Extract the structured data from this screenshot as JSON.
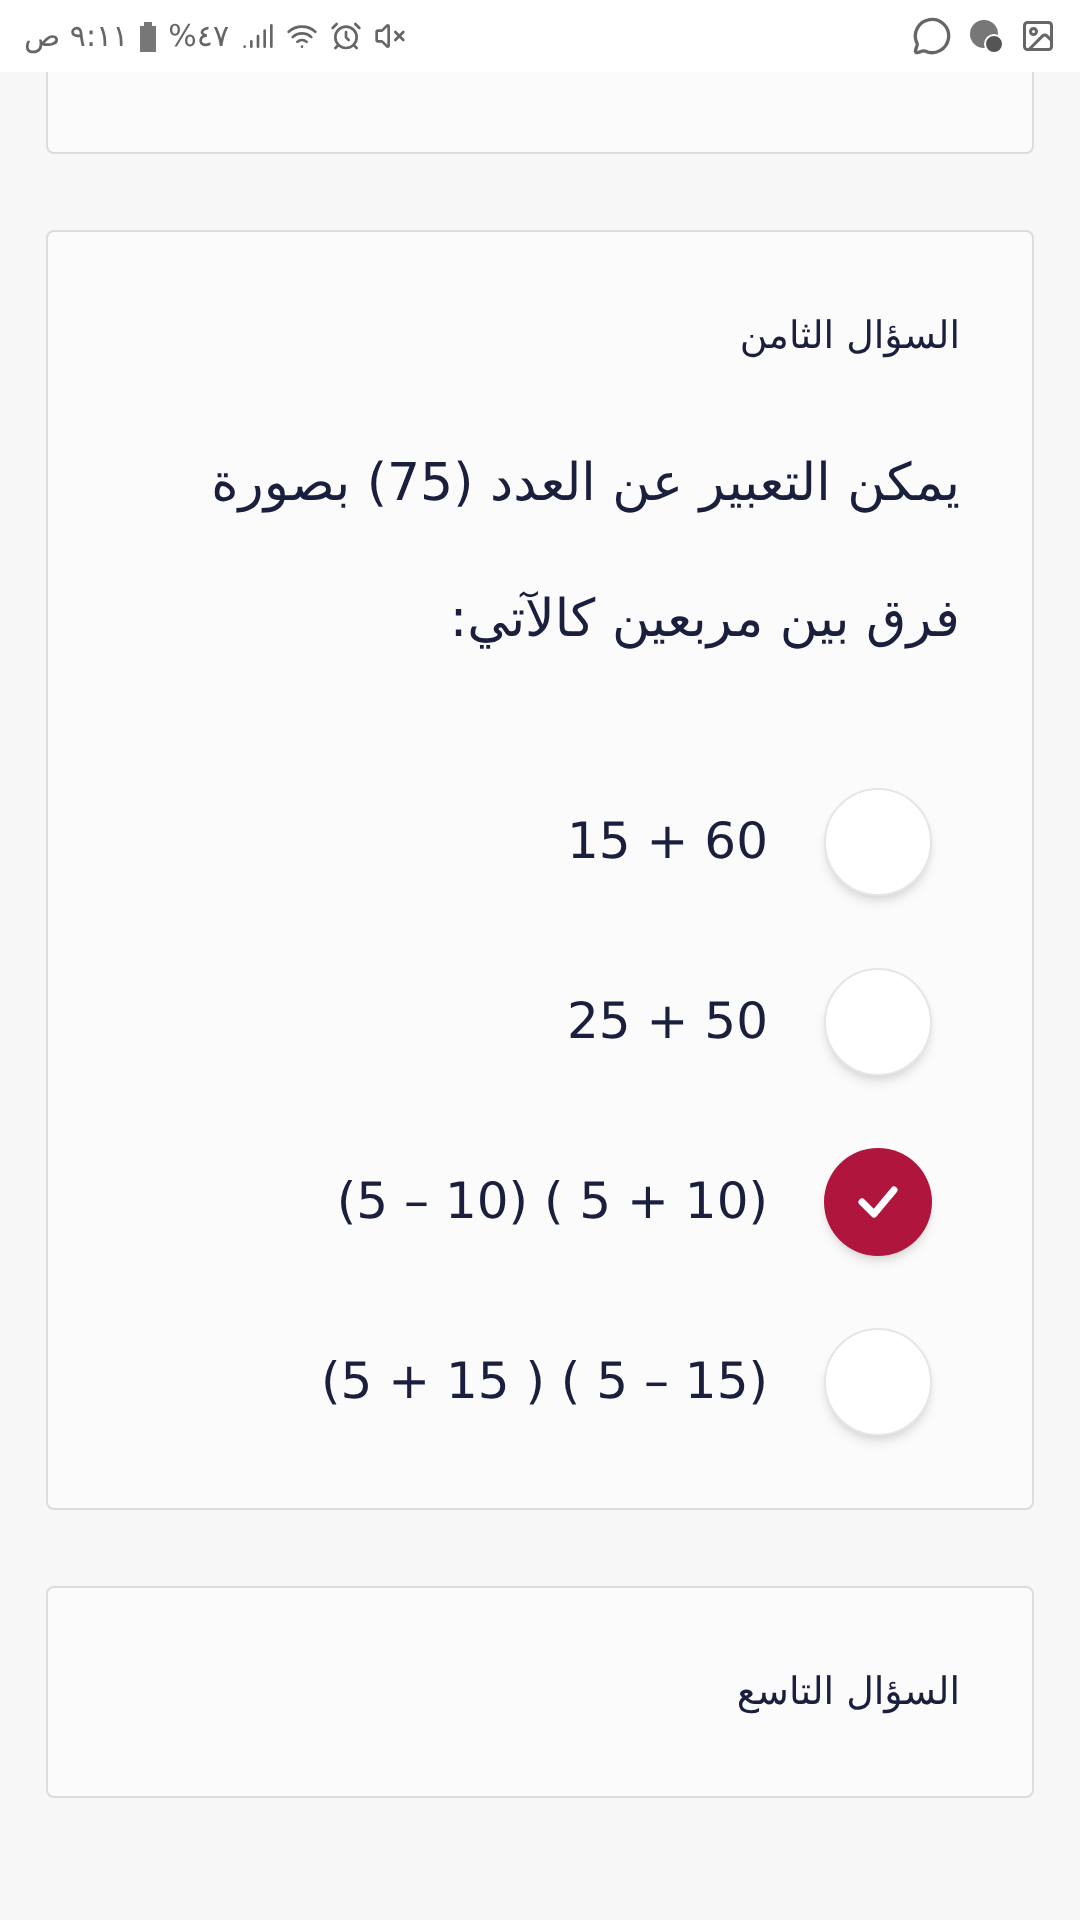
{
  "status_bar": {
    "time": "٩:١١ ص",
    "battery": "%٤٧"
  },
  "questions": [
    {
      "title": "السؤال الثامن",
      "text": "يمكن التعبير عن العدد (75) بصورة فرق بين مربعين كالآتي:",
      "options": [
        {
          "label": "15 + 60",
          "selected": false
        },
        {
          "label": "25 + 50",
          "selected": false
        },
        {
          "label": "(5 – 10) ( 5 + 10)",
          "selected": true
        },
        {
          "label": "(5 + 15 ) ( 5 – 15)",
          "selected": false
        }
      ]
    },
    {
      "title": "السؤال التاسع"
    }
  ]
}
